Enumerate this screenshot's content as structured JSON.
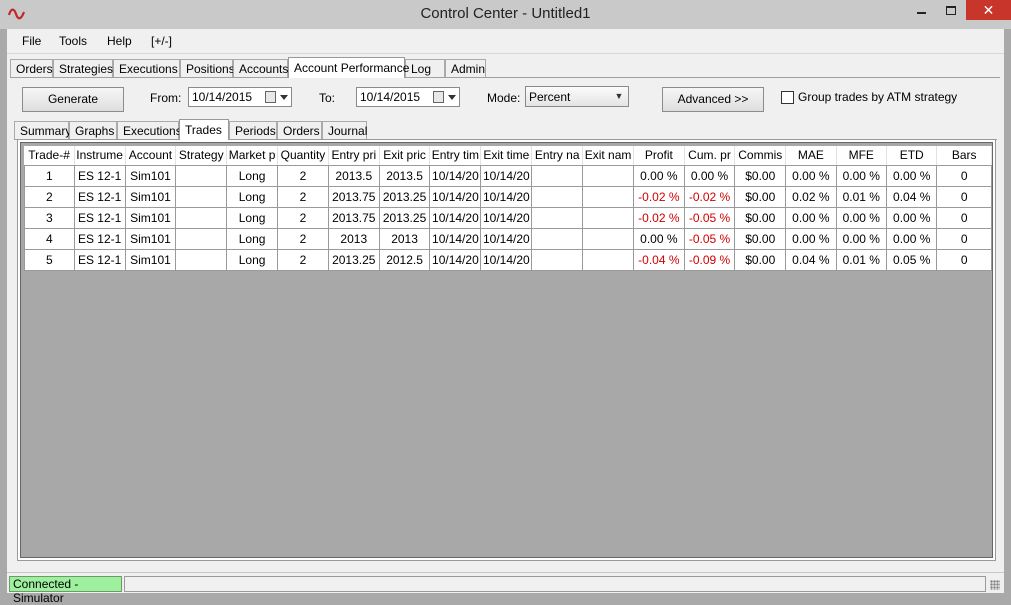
{
  "window": {
    "title": "Control Center - Untitled1",
    "app_icon": "wave-logo-icon",
    "close_glyph": "✕"
  },
  "menu": [
    "File",
    "Tools",
    "Help",
    "[+/-]"
  ],
  "main_tabs": [
    "Orders",
    "Strategies",
    "Executions",
    "Positions",
    "Accounts",
    "Account Performance",
    "Log",
    "Admin"
  ],
  "main_tab_active": "Account Performance",
  "toolbar": {
    "generate_label": "Generate",
    "from_label": "From:",
    "from_value": "10/14/2015",
    "to_label": "To:",
    "to_value": "10/14/2015",
    "mode_label": "Mode:",
    "mode_value": "Percent",
    "advanced_label": "Advanced >>",
    "group_label": "Group trades by ATM strategy",
    "group_checked": false
  },
  "sub_tabs": [
    "Summary",
    "Graphs",
    "Executions",
    "Trades",
    "Periods",
    "Orders",
    "Journal"
  ],
  "sub_tab_active": "Trades",
  "table": {
    "columns": [
      "Trade-#",
      "Instrume",
      "Account",
      "Strategy",
      "Market p",
      "Quantity",
      "Entry pri",
      "Exit pric",
      "Entry tim",
      "Exit time",
      "Entry na",
      "Exit nam",
      "Profit",
      "Cum. pr",
      "Commis",
      "MAE",
      "MFE",
      "ETD",
      "Bars"
    ],
    "rows": [
      [
        "1",
        "ES 12-1",
        "Sim101",
        "",
        "Long",
        "2",
        "2013.5",
        "2013.5",
        "10/14/20",
        "10/14/20",
        "",
        "",
        "0.00 %",
        "0.00 %",
        "$0.00",
        "0.00 %",
        "0.00 %",
        "0.00 %",
        "0"
      ],
      [
        "2",
        "ES 12-1",
        "Sim101",
        "",
        "Long",
        "2",
        "2013.75",
        "2013.25",
        "10/14/20",
        "10/14/20",
        "",
        "",
        "-0.02 %",
        "-0.02 %",
        "$0.00",
        "0.02 %",
        "0.01 %",
        "0.04 %",
        "0"
      ],
      [
        "3",
        "ES 12-1",
        "Sim101",
        "",
        "Long",
        "2",
        "2013.75",
        "2013.25",
        "10/14/20",
        "10/14/20",
        "",
        "",
        "-0.02 %",
        "-0.05 %",
        "$0.00",
        "0.00 %",
        "0.00 %",
        "0.00 %",
        "0"
      ],
      [
        "4",
        "ES 12-1",
        "Sim101",
        "",
        "Long",
        "2",
        "2013",
        "2013",
        "10/14/20",
        "10/14/20",
        "",
        "",
        "0.00 %",
        "-0.05 %",
        "$0.00",
        "0.00 %",
        "0.00 %",
        "0.00 %",
        "0"
      ],
      [
        "5",
        "ES 12-1",
        "Sim101",
        "",
        "Long",
        "2",
        "2013.25",
        "2012.5",
        "10/14/20",
        "10/14/20",
        "",
        "",
        "-0.04 %",
        "-0.09 %",
        "$0.00",
        "0.04 %",
        "0.01 %",
        "0.05 %",
        "0"
      ]
    ]
  },
  "status": {
    "connection": "Connected - Simulator",
    "connection_color": "#9ef09e"
  },
  "colors": {
    "negative": "#d10000",
    "close_button": "#c7352b"
  }
}
